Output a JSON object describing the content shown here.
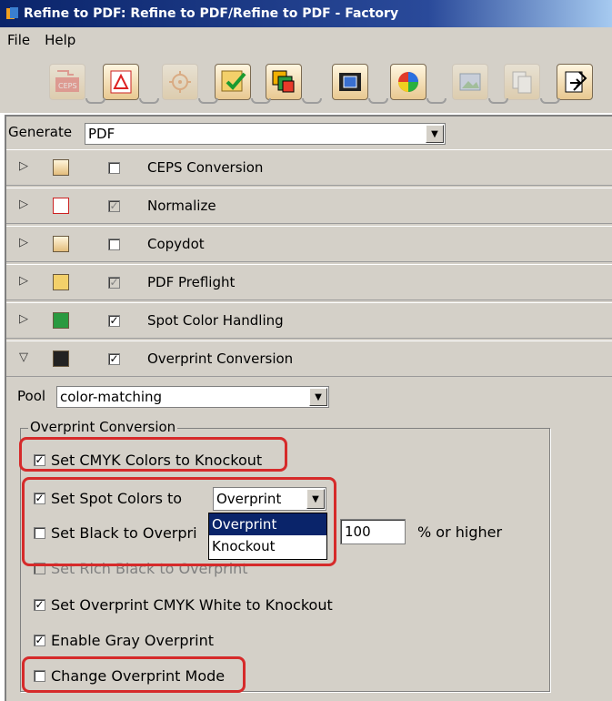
{
  "window": {
    "title": "Refine to PDF: Refine to PDF/Refine to PDF - Factory"
  },
  "menu": {
    "items": [
      "File",
      "Help"
    ]
  },
  "toolbar": {
    "buttons": [
      {
        "icon": "ceps-conversion-icon",
        "text": "CEPS",
        "enabled": false
      },
      {
        "icon": "normalize-pdf-icon",
        "enabled": true
      },
      {
        "icon": "copydot-icon",
        "enabled": false
      },
      {
        "icon": "preflight-icon",
        "enabled": true
      },
      {
        "icon": "spot-color-icon",
        "enabled": true
      },
      {
        "icon": "overprint-icon",
        "enabled": true
      },
      {
        "icon": "color-wheel-icon",
        "enabled": true
      },
      {
        "icon": "image-icon",
        "enabled": false
      },
      {
        "icon": "copy-pages-icon",
        "enabled": false
      },
      {
        "icon": "edit-document-icon",
        "enabled": true
      }
    ]
  },
  "generate": {
    "label": "Generate",
    "value": "PDF"
  },
  "sections": [
    {
      "label": "CEPS Conversion",
      "checked": false,
      "disabled": false,
      "expanded": false,
      "icon": "ceps-icon"
    },
    {
      "label": "Normalize",
      "checked": true,
      "disabled": true,
      "expanded": false,
      "icon": "pdf-icon"
    },
    {
      "label": "Copydot",
      "checked": false,
      "disabled": false,
      "expanded": false,
      "icon": "copydot-icon"
    },
    {
      "label": "PDF Preflight",
      "checked": true,
      "disabled": true,
      "expanded": false,
      "icon": "preflight-icon"
    },
    {
      "label": "Spot Color Handling",
      "checked": true,
      "disabled": false,
      "expanded": false,
      "icon": "spot-color-icon"
    },
    {
      "label": "Overprint Conversion",
      "checked": true,
      "disabled": false,
      "expanded": true,
      "icon": "overprint-icon"
    }
  ],
  "pool": {
    "label": "Pool",
    "value": "color-matching"
  },
  "overprint": {
    "group_title": "Overprint Conversion",
    "set_cmyk": {
      "label": "Set CMYK Colors to Knockout",
      "checked": true
    },
    "set_spot": {
      "label": "Set Spot Colors to",
      "checked": true,
      "value": "Overprint"
    },
    "set_black": {
      "label": "Set Black to Overprint",
      "label_visible": "Set Black to Overpri",
      "checked": false,
      "value": "100",
      "suffix": "% or higher"
    },
    "set_rich_black": {
      "label": "Set Rich Black to Overprint",
      "checked": false,
      "disabled": true
    },
    "set_white": {
      "label": "Set Overprint CMYK White to Knockout",
      "checked": true
    },
    "gray": {
      "label": "Enable Gray Overprint",
      "checked": true
    },
    "mode": {
      "label": "Change Overprint Mode",
      "checked": false
    },
    "spot_options": [
      "Overprint",
      "Knockout"
    ]
  },
  "colors": {
    "title_bar": "#0a246a",
    "highlight": "#d62a2a",
    "panel": "#d4d0c8"
  }
}
